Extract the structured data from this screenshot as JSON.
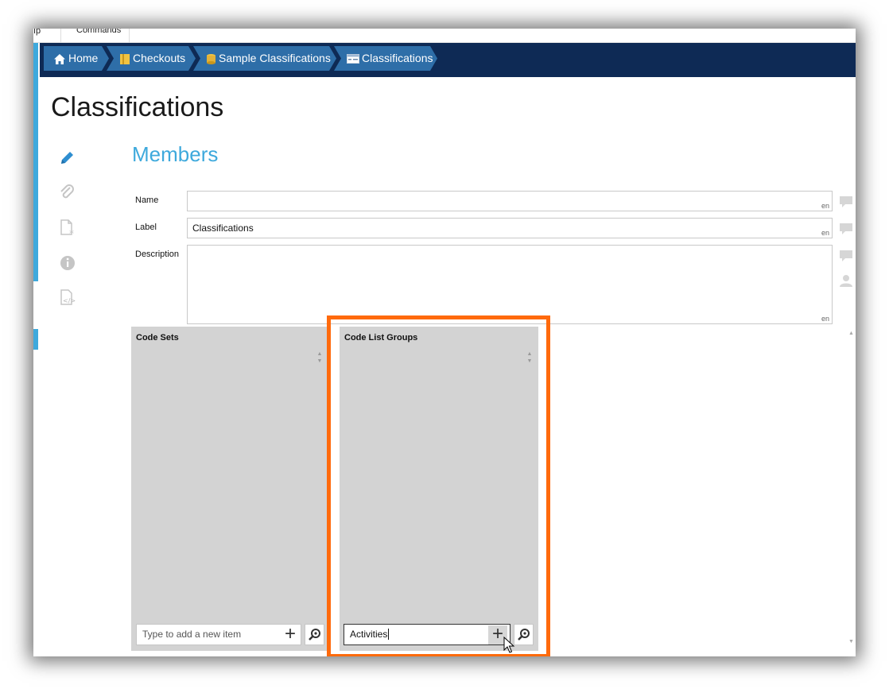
{
  "top_strip": {
    "left_fragment": "ıp",
    "commands_fragment": "Commands"
  },
  "breadcrumbs": [
    {
      "label": "Home",
      "icon": "home-icon"
    },
    {
      "label": "Checkouts",
      "icon": "checkouts-icon"
    },
    {
      "label": "Sample Classifications",
      "icon": "scheme-icon"
    },
    {
      "label": "Classifications",
      "icon": "classification-icon"
    }
  ],
  "page": {
    "title": "Classifications"
  },
  "side_nav": [
    {
      "icon": "pencil-icon",
      "active": true
    },
    {
      "icon": "paperclip-icon",
      "active": false
    },
    {
      "icon": "custom-fields-icon",
      "active": false
    },
    {
      "icon": "info-icon",
      "active": false
    },
    {
      "icon": "xml-icon",
      "active": false
    }
  ],
  "section": {
    "title": "Members"
  },
  "fields": {
    "name": {
      "label": "Name",
      "value": "",
      "lang": "en"
    },
    "label": {
      "label": "Label",
      "value": "Classifications",
      "lang": "en"
    },
    "description": {
      "label": "Description",
      "value": "",
      "lang": "en"
    }
  },
  "panels": {
    "code_sets": {
      "title": "Code Sets",
      "input_value": "",
      "input_placeholder": "Type to add a new item"
    },
    "code_list_groups": {
      "title": "Code List Groups",
      "input_value": "Activities",
      "input_placeholder": "Type to add a new item"
    }
  },
  "colors": {
    "breadcrumb_bar": "#0e2a55",
    "breadcrumb_item": "#2e6ea8",
    "accent": "#3ea9dc",
    "highlight": "#ff6a0c",
    "panel_bg": "#d3d3d3"
  }
}
